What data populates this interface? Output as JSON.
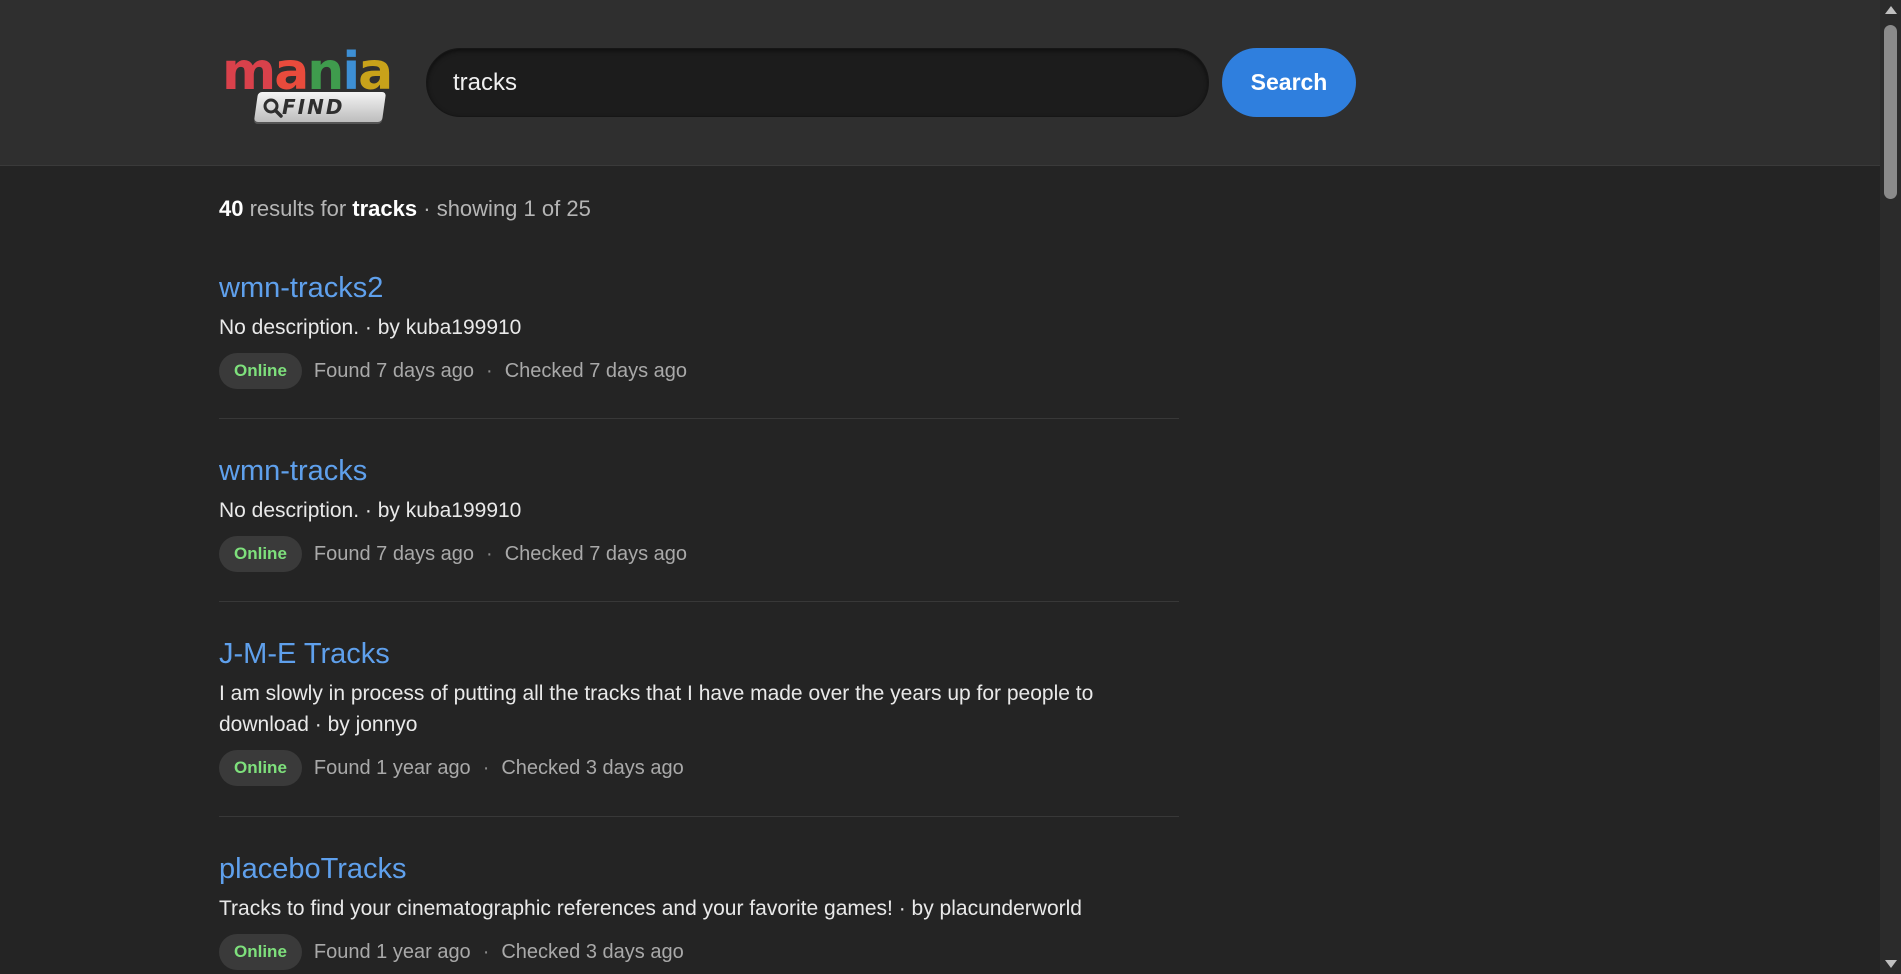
{
  "logo": {
    "word": "mania",
    "sub": "FIND",
    "colors": [
      "#d9414b",
      "#e84b3c",
      "#3f9b4d",
      "#3d8fd4",
      "#c8a21a"
    ]
  },
  "search": {
    "value": "tracks",
    "button_label": "Search"
  },
  "summary": {
    "count": "40",
    "mid_text": " results for ",
    "query": "tracks",
    "tail_text": "  · showing 1 of 25"
  },
  "results": [
    {
      "title": "wmn-tracks2",
      "description": "No description. · by kuba199910",
      "status": "Online",
      "found": "Found 7 days ago",
      "checked": "Checked 7 days ago"
    },
    {
      "title": "wmn-tracks",
      "description": "No description. · by kuba199910",
      "status": "Online",
      "found": "Found 7 days ago",
      "checked": "Checked 7 days ago"
    },
    {
      "title": "J-M-E Tracks",
      "description": "I am slowly in process of putting all the tracks that I have made over the years up for people to download · by jonnyo",
      "status": "Online",
      "found": "Found 1 year ago",
      "checked": "Checked 3 days ago"
    },
    {
      "title": "placeboTracks",
      "description": "Tracks to find your cinematographic references and your favorite games! · by placunderworld",
      "status": "Online",
      "found": "Found 1 year ago",
      "checked": "Checked 3 days ago"
    }
  ],
  "meta_separator": "·",
  "colors": {
    "accent": "#2f7fde",
    "link": "#5fa0ec",
    "online": "#7ee07c",
    "background": "#242424",
    "header": "#2f2f2f"
  }
}
